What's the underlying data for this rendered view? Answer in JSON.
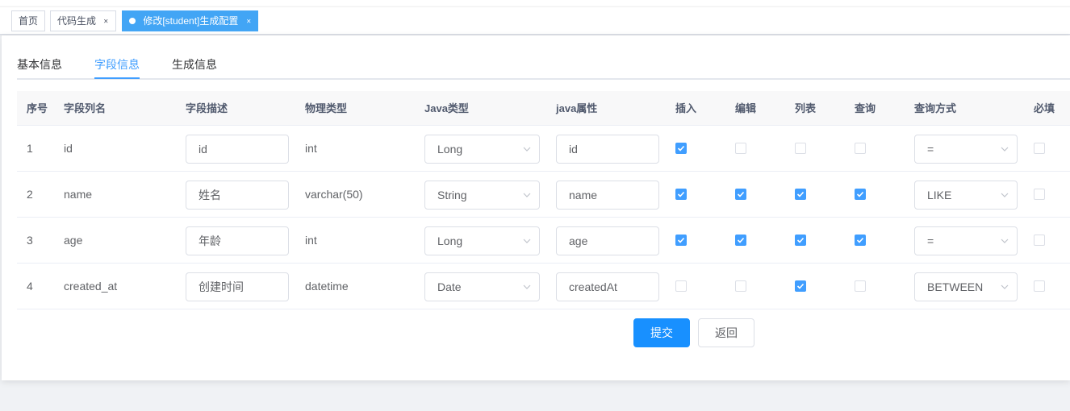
{
  "tags": [
    {
      "label": "首页",
      "closable": false
    },
    {
      "label": "代码生成",
      "closable": true
    },
    {
      "label": "修改[student]生成配置",
      "closable": true,
      "active": true
    }
  ],
  "tabs": [
    {
      "label": "基本信息"
    },
    {
      "label": "字段信息",
      "active": true
    },
    {
      "label": "生成信息"
    }
  ],
  "columns": {
    "seq": "序号",
    "column_name": "字段列名",
    "description": "字段描述",
    "physical_type": "物理类型",
    "java_type": "Java类型",
    "java_field": "java属性",
    "insert": "插入",
    "edit": "编辑",
    "list": "列表",
    "query": "查询",
    "query_type": "查询方式",
    "required": "必填"
  },
  "rows": [
    {
      "seq": "1",
      "column_name": "id",
      "description": "id",
      "physical_type": "int",
      "java_type": "Long",
      "java_field": "id",
      "insert": true,
      "edit": false,
      "list": false,
      "query": false,
      "query_type": "=",
      "required": false
    },
    {
      "seq": "2",
      "column_name": "name",
      "description": "姓名",
      "physical_type": "varchar(50)",
      "java_type": "String",
      "java_field": "name",
      "insert": true,
      "edit": true,
      "list": true,
      "query": true,
      "query_type": "LIKE",
      "required": false
    },
    {
      "seq": "3",
      "column_name": "age",
      "description": "年龄",
      "physical_type": "int",
      "java_type": "Long",
      "java_field": "age",
      "insert": true,
      "edit": true,
      "list": true,
      "query": true,
      "query_type": "=",
      "required": false
    },
    {
      "seq": "4",
      "column_name": "created_at",
      "description": "创建时间",
      "physical_type": "datetime",
      "java_type": "Date",
      "java_field": "createdAt",
      "insert": false,
      "edit": false,
      "list": true,
      "query": false,
      "query_type": "BETWEEN",
      "required": false
    }
  ],
  "buttons": {
    "submit": "提交",
    "back": "返回"
  },
  "colors": {
    "primary": "#1890ff",
    "active_tag": "#42a5f5",
    "checkbox_checked": "#409eff"
  },
  "icons": {
    "close": "close-icon",
    "chevron": "chevron-down-icon",
    "check": "check-icon",
    "dot": "dot-icon"
  }
}
